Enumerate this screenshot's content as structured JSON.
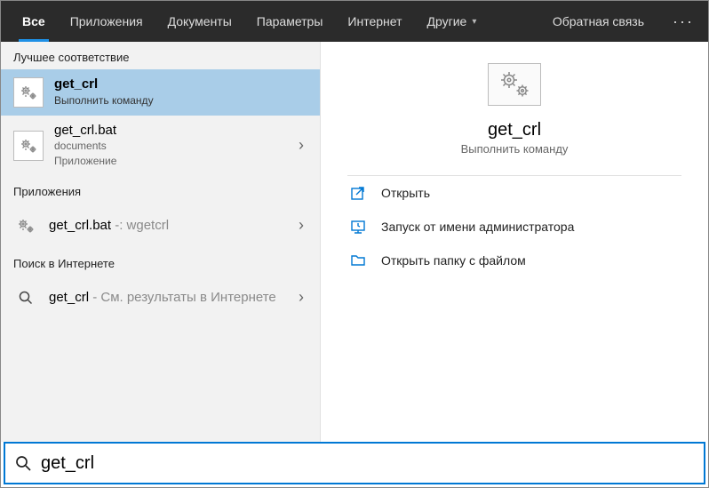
{
  "tabs": {
    "all": "Все",
    "apps": "Приложения",
    "docs": "Документы",
    "params": "Параметры",
    "internet": "Интернет",
    "other": "Другие"
  },
  "topbar": {
    "feedback": "Обратная связь"
  },
  "left": {
    "best_match": "Лучшее соответствие",
    "item1": {
      "title": "get_crl",
      "sub": "Выполнить команду"
    },
    "item2": {
      "title": "get_crl.bat",
      "sub1": "documents",
      "sub2": "Приложение"
    },
    "apps_header": "Приложения",
    "item3": {
      "title": "get_crl.bat",
      "suffix": " -: wgetcrl"
    },
    "internet_header": "Поиск в Интернете",
    "item4": {
      "title": "get_crl",
      "suffix": " - См. результаты в Интернете"
    }
  },
  "preview": {
    "title": "get_crl",
    "sub": "Выполнить команду"
  },
  "actions": {
    "open": "Открыть",
    "admin": "Запуск от имени администратора",
    "folder": "Открыть папку с файлом"
  },
  "search": {
    "value": "get_crl"
  }
}
